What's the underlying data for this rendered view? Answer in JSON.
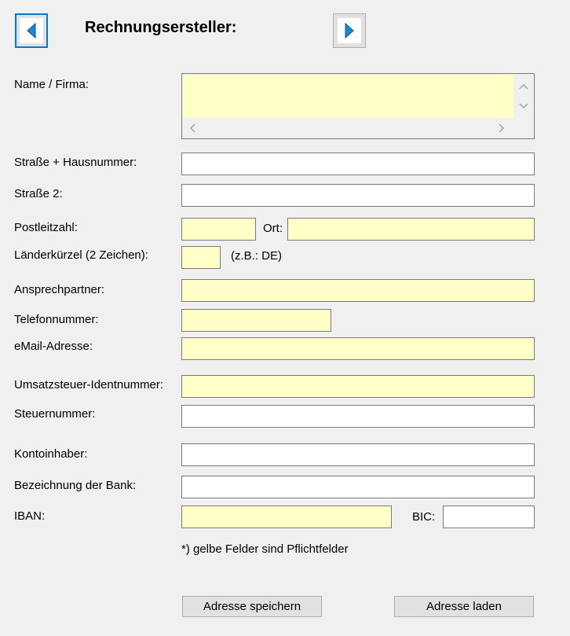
{
  "header": {
    "title": "Rechnungsersteller:",
    "prev_icon": "triangle-left-icon",
    "next_icon": "triangle-right-icon",
    "icon_color": "#1b87d6"
  },
  "form": {
    "name_label": "Name / Firma:",
    "street_label": "Straße + Hausnummer:",
    "street2_label": "Straße 2:",
    "zip_label": "Postleitzahl:",
    "city_label": "Ort:",
    "country_label": "Länderkürzel (2 Zeichen):",
    "country_hint": "(z.B.: DE)",
    "contact_label": "Ansprechpartner:",
    "phone_label": "Telefonnummer:",
    "email_label": "eMail-Adresse:",
    "vat_label": "Umsatzsteuer-Identnummer:",
    "tax_label": "Steuernummer:",
    "account_holder_label": "Kontoinhaber:",
    "bank_label": "Bezeichnung der Bank:",
    "iban_label": "IBAN:",
    "bic_label": "BIC:",
    "required_note": "*) gelbe Felder sind Pflichtfelder",
    "required_color": "#ffffc8",
    "values": {
      "name": "",
      "street": "",
      "street2": "",
      "zip": "",
      "city": "",
      "country": "",
      "contact": "",
      "phone": "",
      "email": "",
      "vat": "",
      "tax": "",
      "account_holder": "",
      "bank": "",
      "iban": "",
      "bic": ""
    }
  },
  "buttons": {
    "save": "Adresse speichern",
    "load": "Adresse laden"
  }
}
